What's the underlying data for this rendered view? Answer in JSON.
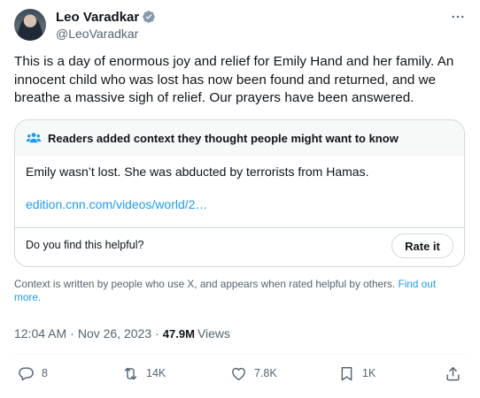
{
  "author": {
    "display_name": "Leo Varadkar",
    "handle": "@LeoVaradkar",
    "verified_icon": "verified-badge-icon"
  },
  "tweet": {
    "text": "This is a day of enormous joy and relief for Emily Hand and her family. An innocent child who was lost has now been found and returned, and we breathe a massive sigh of relief.  Our prayers have been answered."
  },
  "community_note": {
    "header": "Readers added context they thought people might want to know",
    "body": "Emily wasn’t lost. She was abducted by terrorists from Hamas.",
    "link_text": "edition.cnn.com/videos/world/2…",
    "helpful_question": "Do you find this helpful?",
    "rate_label": "Rate it"
  },
  "context_footer": {
    "text": "Context is written by people who use X, and appears when rated helpful by others.",
    "link_text": "Find out more."
  },
  "meta": {
    "time": "12:04 AM",
    "separator": "·",
    "date": "Nov 26, 2023",
    "views_count": "47.9M",
    "views_label": "Views"
  },
  "actions": {
    "replies": "8",
    "reposts": "14K",
    "likes": "7.8K",
    "bookmarks": "1K"
  },
  "colors": {
    "accent": "#1d9bf0",
    "text_primary": "#0f1419",
    "text_secondary": "#536471",
    "border": "#cfd9de"
  }
}
